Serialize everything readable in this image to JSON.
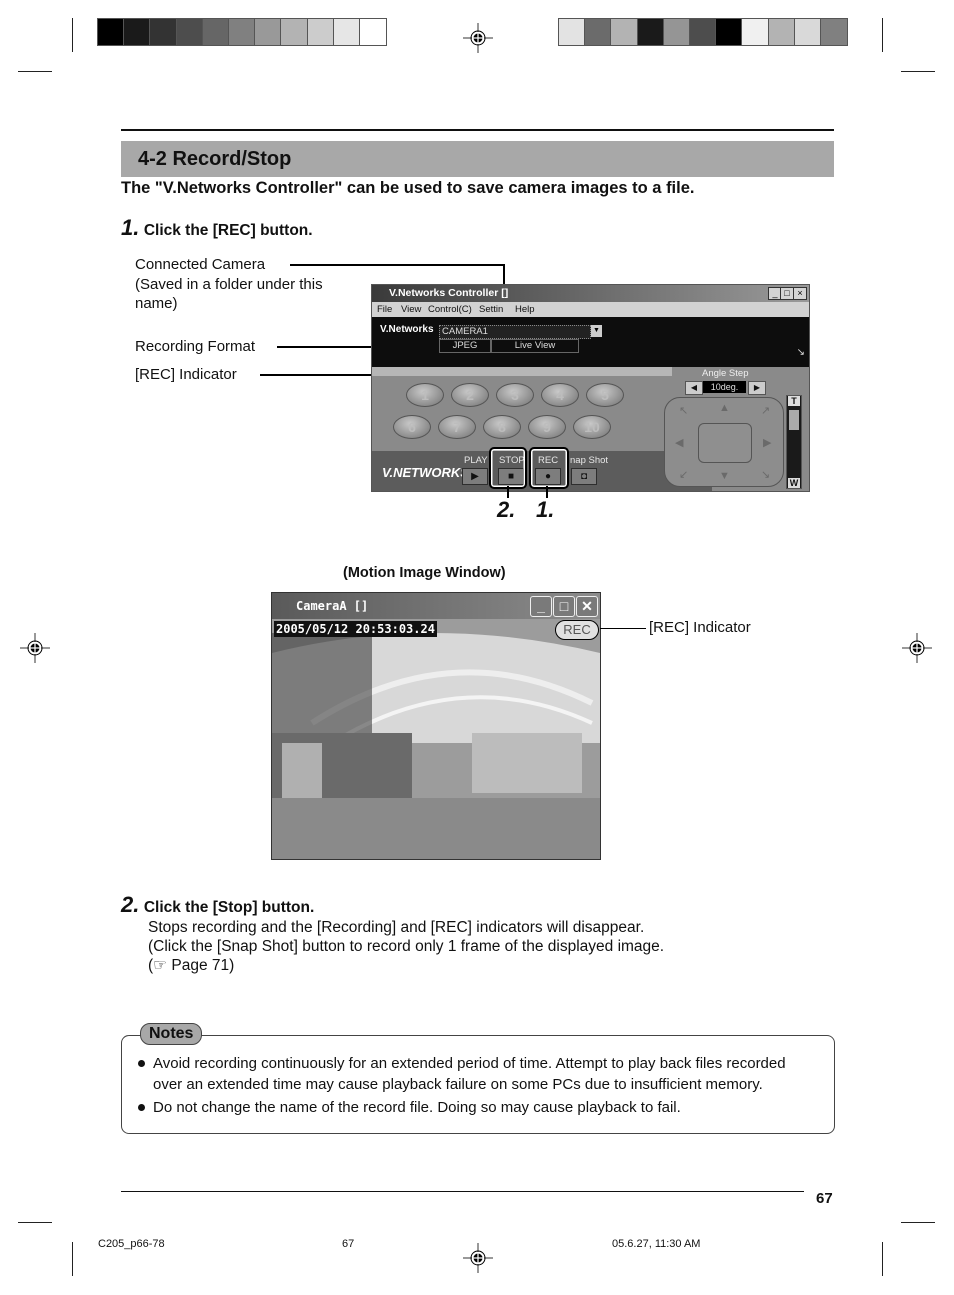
{
  "print_marks": {
    "left_bar_shades": [
      "#000000",
      "#1a1a1a",
      "#333333",
      "#4d4d4d",
      "#666666",
      "#808080",
      "#999999",
      "#b3b3b3",
      "#cccccc",
      "#e6e6e6",
      "#ffffff"
    ],
    "right_bar_shades": [
      "#e3e3e3",
      "#6b6b6b",
      "#b3b3b3",
      "#1a1a1a",
      "#959595",
      "#4d4d4d",
      "#000000",
      "#f0f0f0",
      "#b3b3b3",
      "#d9d9d9",
      "#808080"
    ]
  },
  "section": {
    "title": "4-2 Record/Stop",
    "intro": "The \"V.Networks Controller\" can  be used to save camera images to a file."
  },
  "step1": {
    "number": "1.",
    "title": "Click the [REC] button.",
    "callouts": {
      "connected_camera": "Connected Camera",
      "connected_camera_note1": "(Saved in a folder under this",
      "connected_camera_note2": "name)",
      "recording_format": "Recording Format",
      "rec_indicator": "[REC] Indicator"
    },
    "markers": {
      "stop": "2.",
      "rec": "1."
    }
  },
  "controller": {
    "title": "V.Networks Controller  []",
    "window_buttons": [
      "_",
      "□",
      "×"
    ],
    "menu": [
      "File",
      "View",
      "Control(C)",
      "Settin",
      "Help"
    ],
    "brand": "V.Networks",
    "camera_select": "CAMERA1",
    "format": "JPEG",
    "mode": "Live View",
    "presets": [
      "1",
      "2",
      "3",
      "4",
      "5",
      "6",
      "7",
      "8",
      "9",
      "10"
    ],
    "angle_step_label": "Angle Step",
    "angle_step_value": "10deg.",
    "zoom_tele": "T",
    "zoom_wide": "W",
    "logo": "V.NETWORKS",
    "buttons": {
      "play": "PLAY",
      "stop": "STOP",
      "rec": "REC",
      "snap": "nap Shot"
    }
  },
  "motion_window": {
    "caption": "(Motion Image Window)",
    "title": "CameraA  []",
    "timestamp": "2005/05/12 20:53:03.24",
    "rec_badge": "REC",
    "rec_indicator_label": "[REC] Indicator"
  },
  "step2": {
    "number": "2.",
    "title": "Click the [Stop] button.",
    "lines": [
      "Stops recording and the [Recording] and [REC] indicators will disappear.",
      "(Click the [Snap Shot] button to record only 1 frame of the displayed image.",
      "(☞ Page 71)"
    ]
  },
  "notes": {
    "label": "Notes",
    "items": [
      "Avoid recording continuously for an extended period of time. Attempt to play back files recorded",
      "over an extended time may cause playback failure on some PCs due to insufficient memory.",
      "Do not change the name of the record file. Doing so may cause playback to fail."
    ]
  },
  "footer": {
    "page_number": "67",
    "file_name": "C205_p66-78",
    "slug_page": "67",
    "timestamp": "05.6.27, 11:30 AM"
  }
}
